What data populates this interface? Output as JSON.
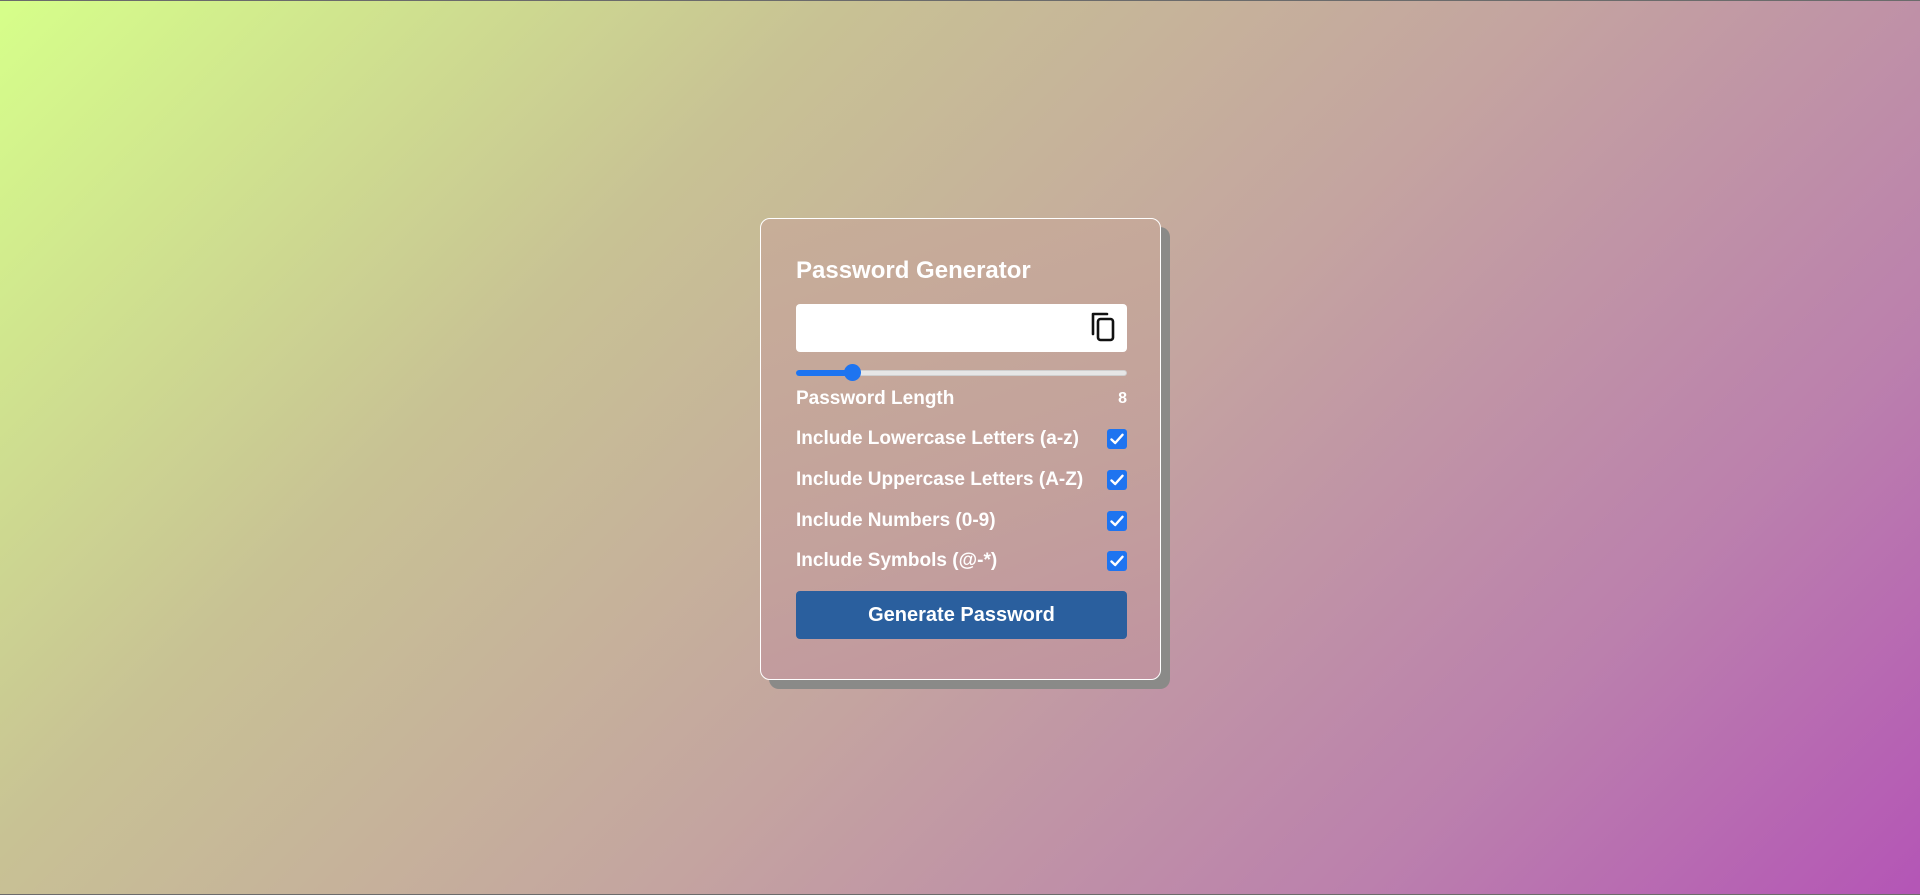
{
  "app": {
    "title": "Password Generator"
  },
  "password": {
    "value": "",
    "placeholder": "",
    "copy_icon": "copy-icon"
  },
  "length": {
    "label": "Password Length",
    "value": "8",
    "slider_fraction": 0.17
  },
  "options": [
    {
      "label": "Include Lowercase Letters (a-z)",
      "checked": true
    },
    {
      "label": "Include Uppercase Letters (A-Z)",
      "checked": true
    },
    {
      "label": "Include Numbers (0-9)",
      "checked": true
    },
    {
      "label": "Include Symbols (@-*)",
      "checked": true
    }
  ],
  "actions": {
    "generate_label": "Generate Password"
  },
  "colors": {
    "accent": "#1e74f0",
    "button": "#2a5f9e",
    "gradient_start": "#d6ff8a",
    "gradient_end": "#b455b6"
  }
}
